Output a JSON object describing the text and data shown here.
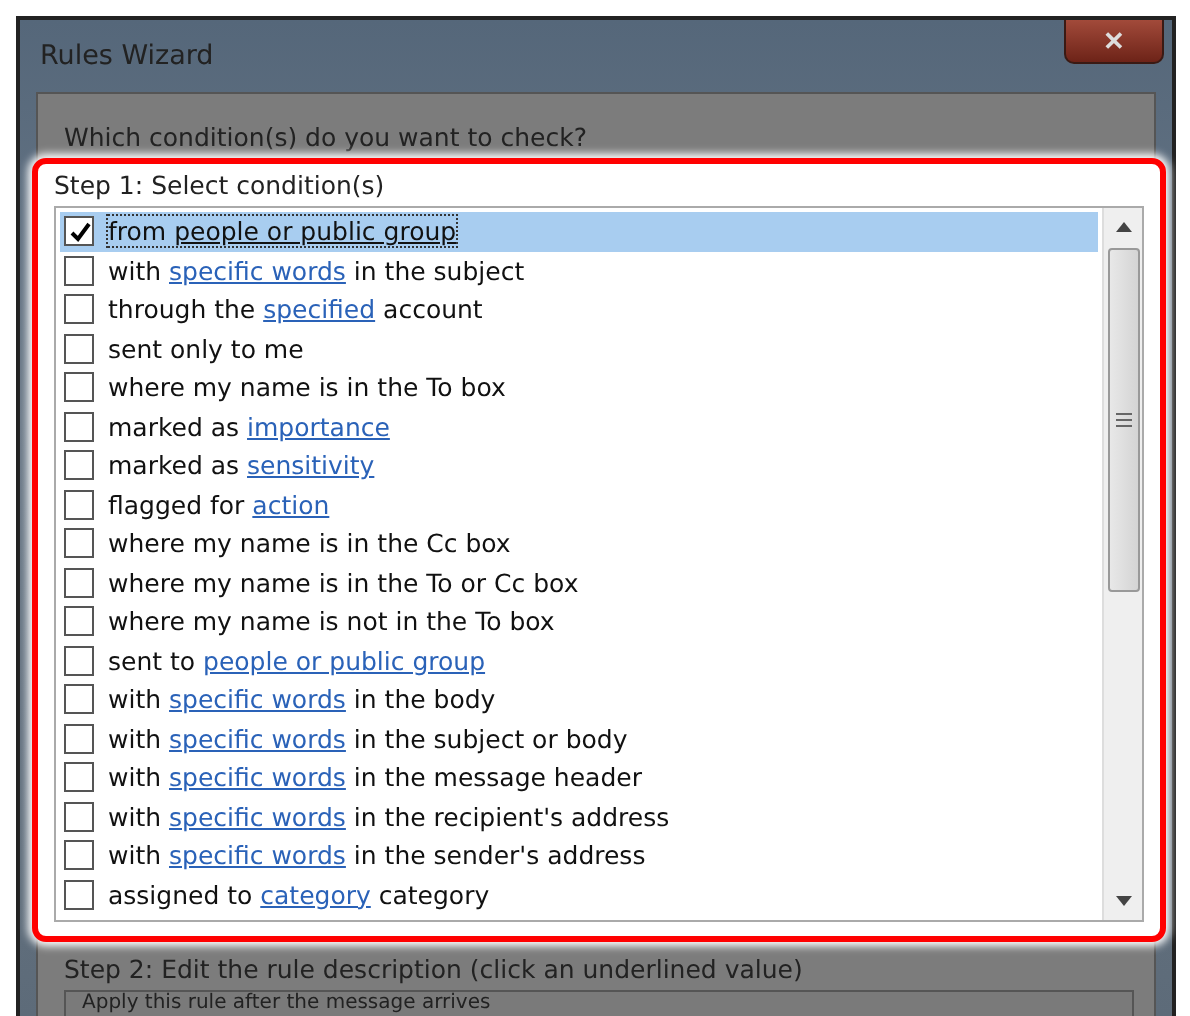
{
  "window": {
    "title": "Rules Wizard",
    "close": "✕"
  },
  "question": "Which condition(s) do you want to check?",
  "step1": {
    "label": "Step 1: Select condition(s)",
    "conditions": [
      {
        "checked": true,
        "selected": true,
        "parts": [
          {
            "kind": "text",
            "text": "from "
          },
          {
            "kind": "link",
            "text": "people or public group"
          }
        ]
      },
      {
        "checked": false,
        "selected": false,
        "parts": [
          {
            "kind": "text",
            "text": "with "
          },
          {
            "kind": "link",
            "text": "specific words"
          },
          {
            "kind": "text",
            "text": " in the subject"
          }
        ]
      },
      {
        "checked": false,
        "selected": false,
        "parts": [
          {
            "kind": "text",
            "text": "through the "
          },
          {
            "kind": "link",
            "text": "specified"
          },
          {
            "kind": "text",
            "text": " account"
          }
        ]
      },
      {
        "checked": false,
        "selected": false,
        "parts": [
          {
            "kind": "text",
            "text": "sent only to me"
          }
        ]
      },
      {
        "checked": false,
        "selected": false,
        "parts": [
          {
            "kind": "text",
            "text": "where my name is in the To box"
          }
        ]
      },
      {
        "checked": false,
        "selected": false,
        "parts": [
          {
            "kind": "text",
            "text": "marked as "
          },
          {
            "kind": "link",
            "text": "importance"
          }
        ]
      },
      {
        "checked": false,
        "selected": false,
        "parts": [
          {
            "kind": "text",
            "text": "marked as "
          },
          {
            "kind": "link",
            "text": "sensitivity"
          }
        ]
      },
      {
        "checked": false,
        "selected": false,
        "parts": [
          {
            "kind": "text",
            "text": "flagged for "
          },
          {
            "kind": "link",
            "text": "action"
          }
        ]
      },
      {
        "checked": false,
        "selected": false,
        "parts": [
          {
            "kind": "text",
            "text": "where my name is in the Cc box"
          }
        ]
      },
      {
        "checked": false,
        "selected": false,
        "parts": [
          {
            "kind": "text",
            "text": "where my name is in the To or Cc box"
          }
        ]
      },
      {
        "checked": false,
        "selected": false,
        "parts": [
          {
            "kind": "text",
            "text": "where my name is not in the To box"
          }
        ]
      },
      {
        "checked": false,
        "selected": false,
        "parts": [
          {
            "kind": "text",
            "text": "sent to "
          },
          {
            "kind": "link",
            "text": "people or public group"
          }
        ]
      },
      {
        "checked": false,
        "selected": false,
        "parts": [
          {
            "kind": "text",
            "text": "with "
          },
          {
            "kind": "link",
            "text": "specific words"
          },
          {
            "kind": "text",
            "text": " in the body"
          }
        ]
      },
      {
        "checked": false,
        "selected": false,
        "parts": [
          {
            "kind": "text",
            "text": "with "
          },
          {
            "kind": "link",
            "text": "specific words"
          },
          {
            "kind": "text",
            "text": " in the subject or body"
          }
        ]
      },
      {
        "checked": false,
        "selected": false,
        "parts": [
          {
            "kind": "text",
            "text": "with "
          },
          {
            "kind": "link",
            "text": "specific words"
          },
          {
            "kind": "text",
            "text": " in the message header"
          }
        ]
      },
      {
        "checked": false,
        "selected": false,
        "parts": [
          {
            "kind": "text",
            "text": "with "
          },
          {
            "kind": "link",
            "text": "specific words"
          },
          {
            "kind": "text",
            "text": " in the recipient's address"
          }
        ]
      },
      {
        "checked": false,
        "selected": false,
        "parts": [
          {
            "kind": "text",
            "text": "with "
          },
          {
            "kind": "link",
            "text": "specific words"
          },
          {
            "kind": "text",
            "text": " in the sender's address"
          }
        ]
      },
      {
        "checked": false,
        "selected": false,
        "parts": [
          {
            "kind": "text",
            "text": "assigned to "
          },
          {
            "kind": "link",
            "text": "category"
          },
          {
            "kind": "text",
            "text": " category"
          }
        ]
      }
    ]
  },
  "step2": {
    "label": "Step 2: Edit the rule description (click an underlined value)",
    "description": "Apply this rule after the message arrives"
  }
}
